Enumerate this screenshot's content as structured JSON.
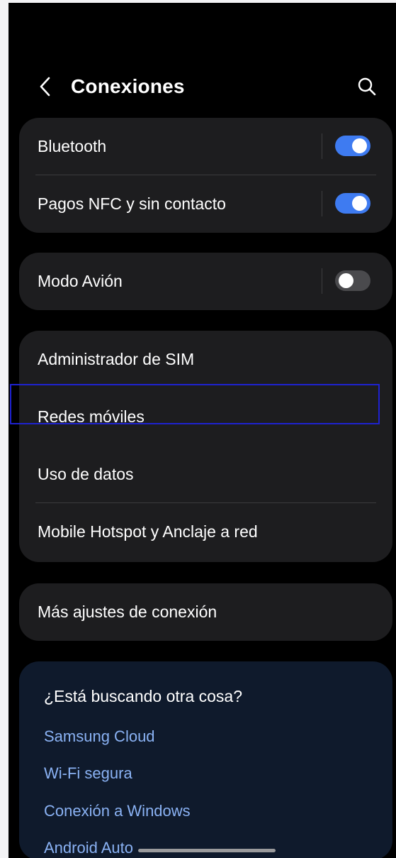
{
  "header": {
    "title": "Conexiones",
    "back_icon": "chevron-left-icon",
    "search_icon": "search-icon"
  },
  "groups": [
    {
      "items": [
        {
          "label": "Bluetooth",
          "toggle": true,
          "state": "on"
        },
        {
          "label": "Pagos NFC y sin contacto",
          "toggle": true,
          "state": "on"
        }
      ]
    },
    {
      "items": [
        {
          "label": "Modo Avión",
          "toggle": true,
          "state": "off"
        }
      ]
    },
    {
      "items": [
        {
          "label": "Administrador de SIM"
        },
        {
          "label": "Redes móviles",
          "highlighted": true
        },
        {
          "label": "Uso de datos"
        },
        {
          "label": "Mobile Hotspot y Anclaje a red"
        }
      ]
    },
    {
      "items": [
        {
          "label": "Más ajustes de conexión"
        }
      ]
    }
  ],
  "suggestions": {
    "title": "¿Está buscando otra cosa?",
    "links": [
      "Samsung Cloud",
      "Wi-Fi segura",
      "Conexión a Windows",
      "Android Auto"
    ]
  },
  "colors": {
    "background": "#000000",
    "card": "#1d1d1f",
    "toggle_on": "#3e7bf1",
    "toggle_off": "#4a4a4d",
    "link": "#8ab2f4",
    "highlight_border": "#1e22d0"
  }
}
